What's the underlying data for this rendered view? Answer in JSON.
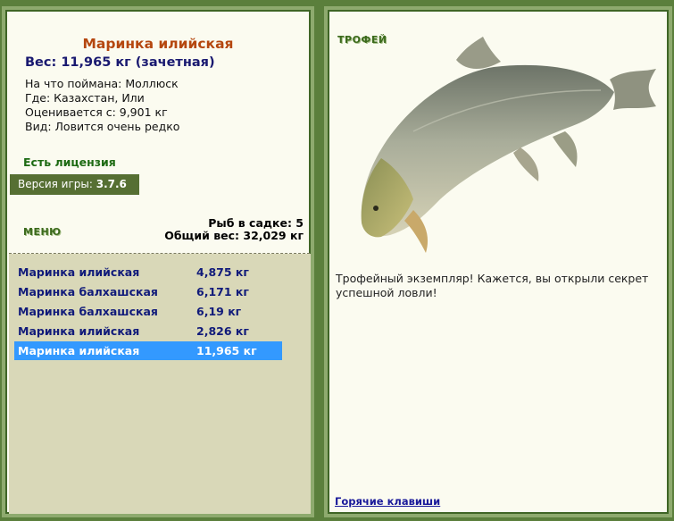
{
  "left": {
    "fish_name": "Маринка илийская",
    "weight_text": "Вес: 11,965 кг (зачетная)",
    "info": [
      "На что поймана: Моллюск",
      "Где: Казахстан, Или",
      "Оценивается с: 9,901 кг",
      "Вид: Ловится очень редко"
    ],
    "license": "Есть лицензия",
    "version_label": "Версия игры:",
    "version_number": "3.7.6",
    "menu_label": "МЕНЮ",
    "cage_count": "Рыб в садке: 5",
    "cage_weight": "Общий вес: 32,029 кг"
  },
  "catch_list": [
    {
      "name": "Маринка илийская",
      "weight": "4,875 кг"
    },
    {
      "name": "Маринка балхашская",
      "weight": "6,171 кг"
    },
    {
      "name": "Маринка балхашская",
      "weight": "6,19 кг"
    },
    {
      "name": "Маринка илийская",
      "weight": "2,826 кг"
    },
    {
      "name": "Маринка илийская",
      "weight": "11,965 кг"
    }
  ],
  "selected_index": 4,
  "right": {
    "trophy_label": "ТРОФЕЙ",
    "trophy_text": "Трофейный экземпляр! Кажется, вы открыли секрет успешной ловли!",
    "hotkeys_link": "Горячие клавиши"
  },
  "colors": {
    "background": "#5b7f3c",
    "panel": "#fbfbf0",
    "title": "#b5470f",
    "accent_blue": "#191970",
    "selection": "#3399ff",
    "list_bg": "#d9d8b8"
  },
  "icons": {
    "fish_image": "fish-image"
  }
}
